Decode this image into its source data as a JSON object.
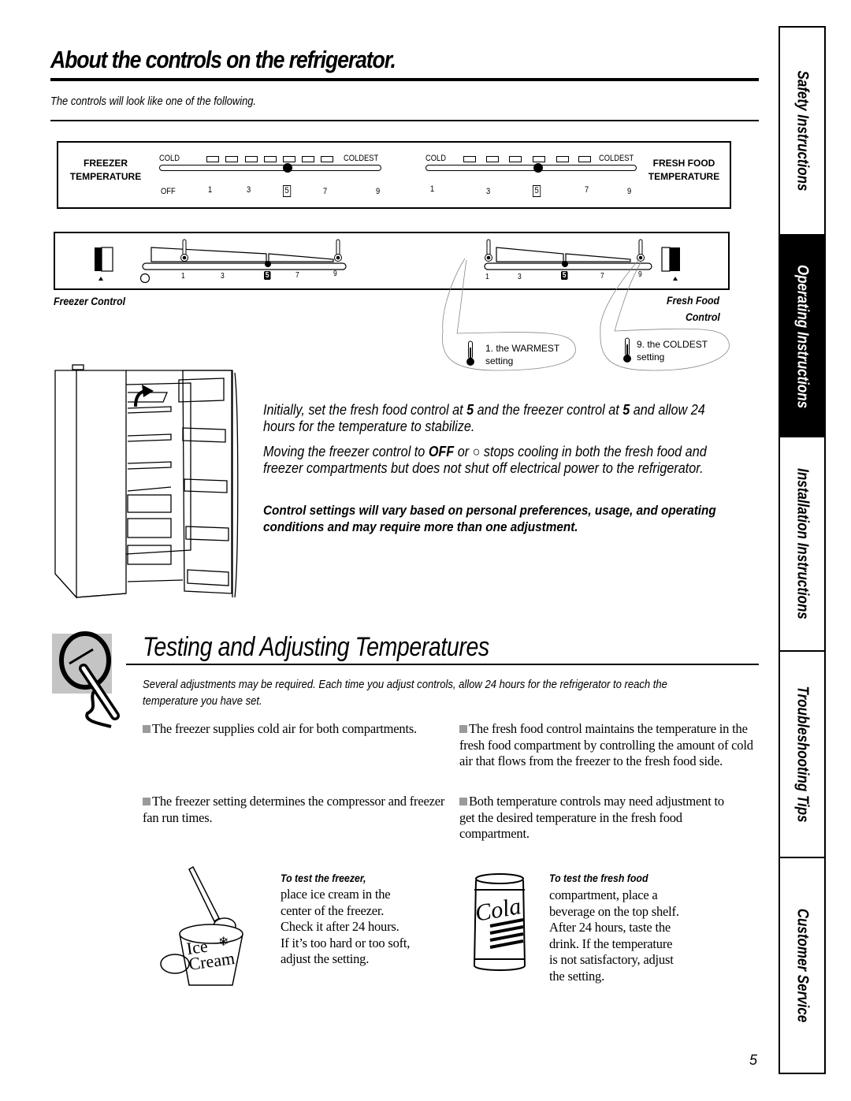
{
  "header": {
    "title": "About the controls on the refrigerator.",
    "subtitle": "The controls will look like one of the following."
  },
  "panel_style_1": {
    "freezer": {
      "label_line1": "FREEZER",
      "label_line2": "TEMPERATURE",
      "scale_left": "COLD",
      "scale_right": "COLDEST",
      "numbers": [
        "OFF",
        "1",
        "3",
        "5",
        "7",
        "9"
      ],
      "selected": "5"
    },
    "fresh_food": {
      "label_line1": "FRESH FOOD",
      "label_line2": "TEMPERATURE",
      "scale_left": "COLD",
      "scale_right": "COLDEST",
      "numbers": [
        "1",
        "3",
        "5",
        "7",
        "9"
      ],
      "selected": "5"
    }
  },
  "panel_style_2": {
    "freezer": {
      "caption": "Freezer Control",
      "numbers": [
        "1",
        "3",
        "5",
        "7",
        "9"
      ],
      "selected": "5",
      "off_symbol": "○"
    },
    "fresh_food": {
      "caption_line1": "Fresh Food",
      "caption_line2": "Control",
      "numbers": [
        "1",
        "3",
        "5",
        "7",
        "9"
      ],
      "selected": "5"
    },
    "callouts": [
      {
        "line1": "1. the WARMEST",
        "line2": "setting"
      },
      {
        "line1": "9. the COLDEST",
        "line2": "setting"
      }
    ]
  },
  "instructions": {
    "p1_a": "Initially, set the fresh food control at ",
    "p1_b": "5",
    "p1_c": " and the freezer control at ",
    "p1_d": "5",
    "p1_e": " and allow 24 hours for the temperature to stabilize.",
    "p2_a": "Moving the freezer control to ",
    "p2_b": "OFF",
    "p2_c": " or ",
    "p2_d": "○",
    "p2_e": " stops cooling in both the fresh food and freezer compartments but does not shut off electrical power to the refrigerator.",
    "p3": "Control settings will vary based on personal preferences, usage, and operating conditions and may require more than one adjustment."
  },
  "testing": {
    "title": "Testing and Adjusting Temperatures",
    "intro": "Several adjustments may be required. Each time you adjust controls, allow 24 hours for the refrigerator to reach the temperature you have set.",
    "bullets_left": [
      "The freezer supplies cold air for both compartments.",
      "The freezer setting determines the compressor and freezer fan run times."
    ],
    "bullets_right": [
      "The fresh food control maintains the temperature in the fresh food compartment by controlling the amount of cold air that flows from the freezer to the fresh food side.",
      "Both temperature controls may need adjustment to get the desired temperature in the fresh food compartment."
    ],
    "freezer_test": {
      "heading": "To test the freezer,",
      "lines": [
        "place ice cream in the",
        "center of the freezer.",
        "Check it after 24 hours.",
        "If it’s too hard or too soft,",
        "adjust the setting."
      ],
      "illustration_text_1": "Ice",
      "illustration_text_2": "Cream"
    },
    "fresh_test": {
      "heading": "To test the fresh food",
      "lines": [
        "compartment, place a",
        "beverage on the top shelf.",
        "After 24 hours, taste the",
        "drink. If the temperature",
        "is not satisfactory, adjust",
        "the setting."
      ],
      "illustration_text": "Cola"
    }
  },
  "side_tabs": [
    {
      "label": "Safety Instructions",
      "active": false
    },
    {
      "label": "Operating Instructions",
      "active": true
    },
    {
      "label": "Installation Instructions",
      "active": false
    },
    {
      "label": "Troubleshooting Tips",
      "active": false
    },
    {
      "label": "Customer Service",
      "active": false
    }
  ],
  "page_number": "5"
}
